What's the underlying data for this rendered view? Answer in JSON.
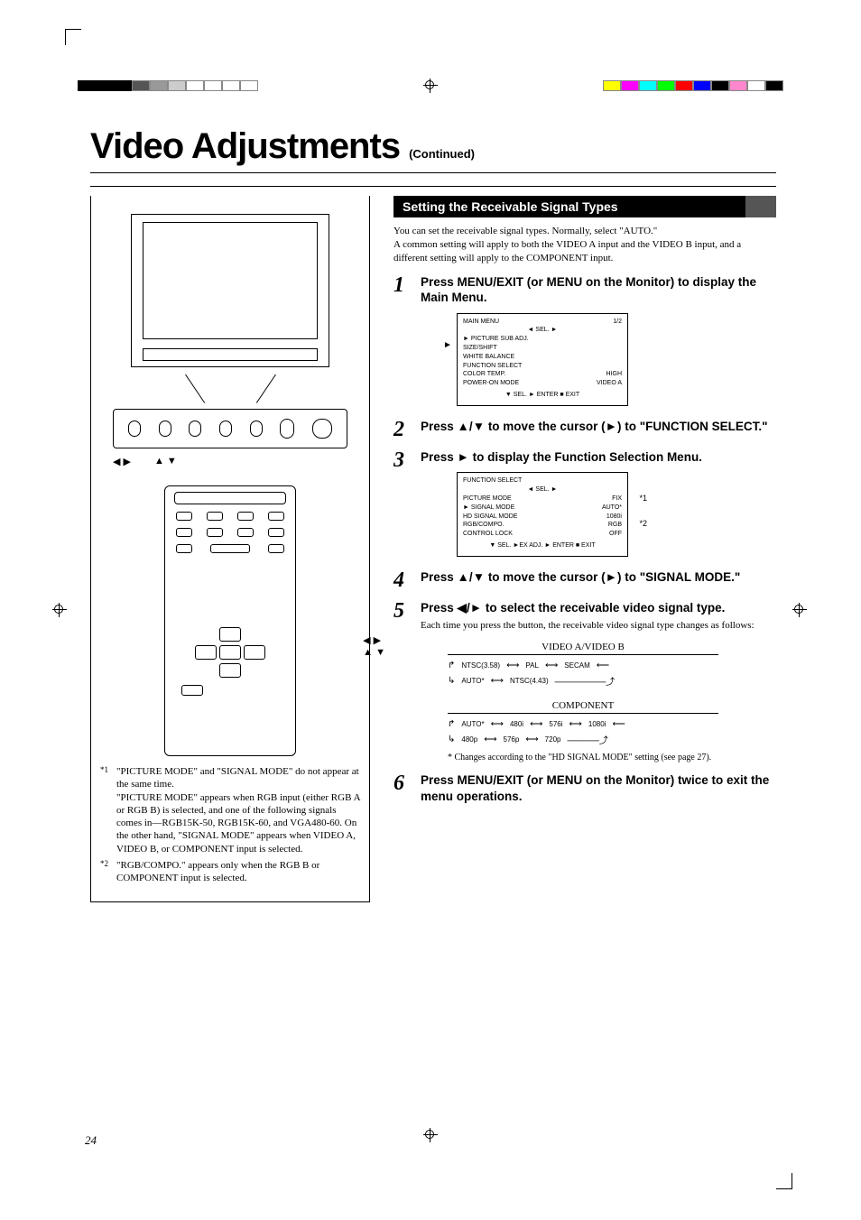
{
  "page": {
    "number": "24",
    "title": "Video Adjustments",
    "continued": "(Continued)"
  },
  "section_title": "Setting the Receivable Signal Types",
  "intro": "You can set the receivable signal types. Normally, select \"AUTO.\"\nA common setting will apply to both the VIDEO A input and the VIDEO B input, and a different setting will apply to the COMPONENT input.",
  "steps": {
    "s1": {
      "head": "Press MENU/EXIT (or MENU on the Monitor) to display the Main Menu."
    },
    "s2": {
      "head": "Press 5/∞ to move the cursor (3) to \"FUNCTION SELECT.\""
    },
    "s3": {
      "head": "Press 3 to display the Function Selection Menu."
    },
    "s4": {
      "head": "Press 5/∞ to move the cursor (3) to \"SIGNAL MODE.\""
    },
    "s5": {
      "head": "Press 2/3 to select the receivable video signal type.",
      "body": "Each time you press the button, the receivable video signal type changes as follows:"
    },
    "s6": {
      "head": "Press MENU/EXIT (or MENU on the Monitor) twice to exit the menu operations."
    }
  },
  "arrow_glyphs": {
    "up": "▲",
    "down": "▼",
    "left": "◀",
    "right": "▶",
    "play": "►"
  },
  "step_heads_parts": {
    "s1a": "Press MENU/EXIT (or MENU on the Monitor) to display the Main Menu.",
    "s2a": "Press ",
    "s2b": "/",
    "s2c": " to move the cursor (",
    "s2d": ") to \"FUNCTION SELECT.\"",
    "s3a": "Press ",
    "s3b": " to display the Function Selection Menu.",
    "s4a": "Press ",
    "s4b": "/",
    "s4c": " to move the cursor (",
    "s4d": ") to \"SIGNAL MODE.\"",
    "s5a": "Press ",
    "s5b": "/",
    "s5c": " to select the receivable video signal type.",
    "s6a": "Press MENU/EXIT (or MENU on the Monitor) twice to exit the menu operations."
  },
  "osd_main": {
    "title_l": "MAIN MENU",
    "title_r": "1/2",
    "arrows": "◄ SEL. ►",
    "rows": [
      [
        "► PICTURE SUB ADJ.",
        " "
      ],
      [
        "  SIZE/SHIFT",
        " "
      ],
      [
        "  WHITE BALANCE",
        " "
      ],
      [
        "  FUNCTION SELECT",
        " "
      ],
      [
        "  COLOR TEMP.",
        "HIGH"
      ],
      [
        "  POWER-ON MODE",
        "VIDEO A"
      ]
    ],
    "footer": "▼ SEL.   ► ENTER   ■ EXIT"
  },
  "osd_func": {
    "title_l": "FUNCTION SELECT",
    "title_r": " ",
    "arrows": "◄ SEL. ►",
    "rows": [
      [
        "  PICTURE MODE",
        "FIX"
      ],
      [
        "► SIGNAL MODE",
        "AUTO*"
      ],
      [
        "  HD SIGNAL MODE",
        "1080i"
      ],
      [
        "  RGB/COMPO.",
        "RGB"
      ],
      [
        "  CONTROL LOCK",
        "OFF"
      ]
    ],
    "footer": "▼ SEL.  ►EX ADJ.  ► ENTER  ■ EXIT",
    "star1": "*1",
    "star2": "*2"
  },
  "sig": {
    "label1": "VIDEO A/VIDEO B",
    "row1": [
      "NTSC(3.58)",
      "PAL",
      "SECAM"
    ],
    "row2": [
      "AUTO*",
      "NTSC(4.43)"
    ],
    "label2": "COMPONENT",
    "row3": [
      "AUTO*",
      "480i",
      "576i",
      "1080i"
    ],
    "row4": [
      "480p",
      "576p",
      "720p"
    ]
  },
  "star_note": "* Changes according to the \"HD SIGNAL MODE\" setting (see page 27).",
  "footnotes": {
    "f1_sup": "*1",
    "f1": "\"PICTURE MODE\" and \"SIGNAL MODE\" do not appear at the same time.\n\"PICTURE MODE\" appears when RGB input (either RGB A or RGB B) is selected, and one of the following signals comes in—RGB15K-50, RGB15K-60, and VGA480-60. On the other hand, \"SIGNAL MODE\" appears when VIDEO A, VIDEO B, or COMPONENT input is selected.",
    "f2_sup": "*2",
    "f2": "\"RGB/COMPO.\" appears only when the RGB B or COMPONENT input is selected."
  },
  "nav_labels": {
    "lr": "◀  ▶",
    "ud": "▲  ▼"
  }
}
